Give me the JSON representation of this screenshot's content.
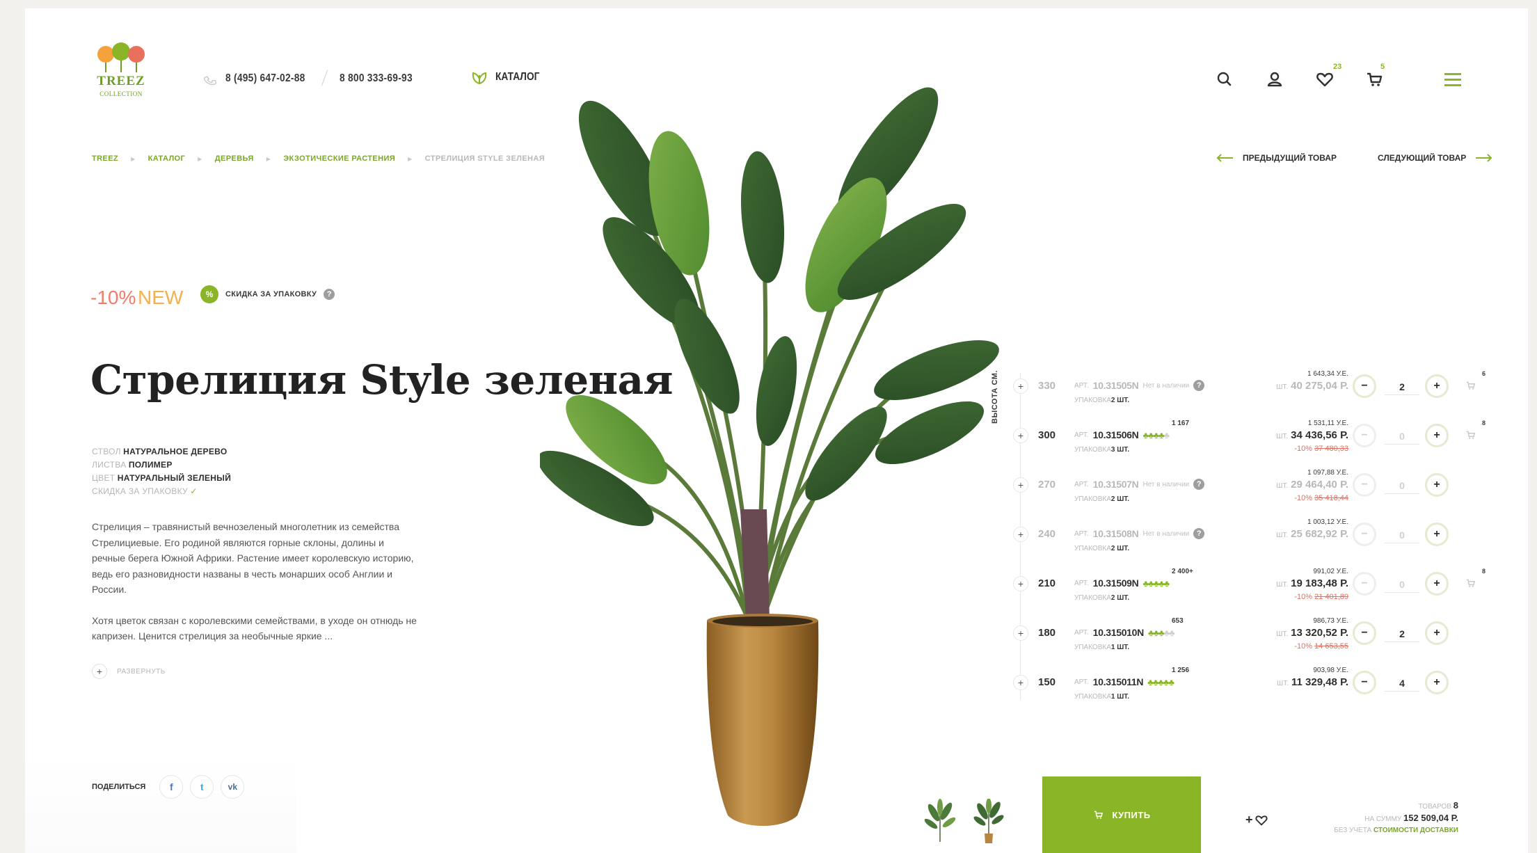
{
  "header": {
    "logo_text": "TREEZ",
    "logo_sub": "COLLECTION",
    "phone_1": "8 (495) 647-02-88",
    "phone_2": "8 800 333-69-93",
    "catalog_label": "КАТАЛОГ",
    "favorites_count": "23",
    "cart_count": "5"
  },
  "breadcrumb": {
    "items": [
      "TREEZ",
      "КАТАЛОГ",
      "ДЕРЕВЬЯ",
      "ЭКЗОТИЧЕСКИЕ РАСТЕНИЯ"
    ],
    "current": "СТРЕЛИЦИЯ STYLE ЗЕЛЕНАЯ"
  },
  "product_nav": {
    "prev_label": "ПРЕДЫДУЩИЙ ТОВАР",
    "next_label": "СЛЕДУЮЩИЙ ТОВАР"
  },
  "badges": {
    "discount": "-10%",
    "new": "NEW",
    "pack_icon": "%",
    "pack_label": "СКИДКА ЗА УПАКОВКУ",
    "help": "?"
  },
  "product": {
    "title": "Стрелиция Style зеленая",
    "attributes": [
      {
        "label": "СТВОЛ",
        "value": "НАТУРАЛЬНОЕ ДЕРЕВО"
      },
      {
        "label": "ЛИСТВА",
        "value": "ПОЛИМЕР"
      },
      {
        "label": "ЦВЕТ",
        "value": "НАТУРАЛЬНЫЙ ЗЕЛЕНЫЙ"
      },
      {
        "label": "СКИДКА ЗА УПАКОВКУ",
        "value": "✓"
      }
    ],
    "description_1": "Стрелиция – травянистый вечнозеленый многолетник из семейства Стрелициевые. Его родиной являются горные склоны, долины и речные берега Южной Африки. Растение имеет королевскую историю, ведь его разновидности названы в честь монарших особ Англии и России.",
    "description_2": "Хотя цветок связан с королевскими семействами, в уходе он отнюдь не капризен. Ценится стрелиция за необычные яркие ...",
    "expand_label": "РАЗВЕРНУТЬ"
  },
  "share": {
    "label": "ПОДЕЛИТЬСЯ",
    "facebook": "f",
    "twitter": "t",
    "vk": "vk"
  },
  "variants": {
    "axis_label": "ВЫСОТА СМ.",
    "art_label": "АРТ.",
    "pack_label": "УПАКОВКА",
    "no_stock_label": "Нет в наличии",
    "unit_label": "ШТ.",
    "rows": [
      {
        "height": "330",
        "art": "10.31505N",
        "in_stock": false,
        "stock": 0,
        "stock_count": "",
        "pack": "2 ШТ.",
        "price_ue": "1 643,34 У.Е.",
        "price_rub": "40 275,04 Р.",
        "old_price": "",
        "disc": "",
        "qty": "2",
        "available": false,
        "cart_count": "6"
      },
      {
        "height": "300",
        "art": "10.31506N",
        "in_stock": true,
        "stock": 4,
        "stock_count": "1 167",
        "pack": "3 ШТ.",
        "price_ue": "1 531,11 У.Е.",
        "price_rub": "34 436,56 Р.",
        "old_price": "37 480,33",
        "disc": "-10%",
        "qty": "0",
        "available": true,
        "cart_count": "8"
      },
      {
        "height": "270",
        "art": "10.31507N",
        "in_stock": false,
        "stock": 0,
        "stock_count": "",
        "pack": "2 ШТ.",
        "price_ue": "1 097,88 У.Е.",
        "price_rub": "29 464,40 Р.",
        "old_price": "35 418,44",
        "disc": "-10%",
        "qty": "0",
        "available": false,
        "cart_count": ""
      },
      {
        "height": "240",
        "art": "10.31508N",
        "in_stock": false,
        "stock": 0,
        "stock_count": "",
        "pack": "2 ШТ.",
        "price_ue": "1 003,12 У.Е.",
        "price_rub": "25 682,92 Р.",
        "old_price": "",
        "disc": "",
        "qty": "0",
        "available": false,
        "cart_count": ""
      },
      {
        "height": "210",
        "art": "10.31509N",
        "in_stock": true,
        "stock": 5,
        "stock_count": "2 400+",
        "pack": "2 ШТ.",
        "price_ue": "991,02 У.Е.",
        "price_rub": "19 183,48 Р.",
        "old_price": "21 401,89",
        "disc": "-10%",
        "qty": "0",
        "available": true,
        "cart_count": "8"
      },
      {
        "height": "180",
        "art": "10.315010N",
        "in_stock": true,
        "stock": 3,
        "stock_count": "653",
        "pack": "1 ШТ.",
        "price_ue": "986,73 У.Е.",
        "price_rub": "13 320,52 Р.",
        "old_price": "14 653,55",
        "disc": "-10%",
        "qty": "2",
        "available": true,
        "cart_count": ""
      },
      {
        "height": "150",
        "art": "10.315011N",
        "in_stock": true,
        "stock": 5,
        "stock_count": "1 256",
        "pack": "1 ШТ.",
        "price_ue": "903,98 У.Е.",
        "price_rub": "11 329,48 Р.",
        "old_price": "",
        "disc": "",
        "qty": "4",
        "available": true,
        "cart_count": ""
      }
    ]
  },
  "bottom_bar": {
    "buy_label": "КУПИТЬ",
    "fav_add": "+",
    "items_label": "ТОВАРОВ",
    "items_count": "8",
    "sum_label": "НА СУММУ",
    "sum_value": "152 509,04 Р.",
    "delivery_prefix": "БЕЗ УЧЕТА",
    "delivery_link": "СТОИМОСТИ ДОСТАВКИ"
  },
  "colors": {
    "accent": "#8ab526",
    "discount": "#f07d6a",
    "new": "#f5b04c",
    "old_price": "#e76e5e"
  }
}
